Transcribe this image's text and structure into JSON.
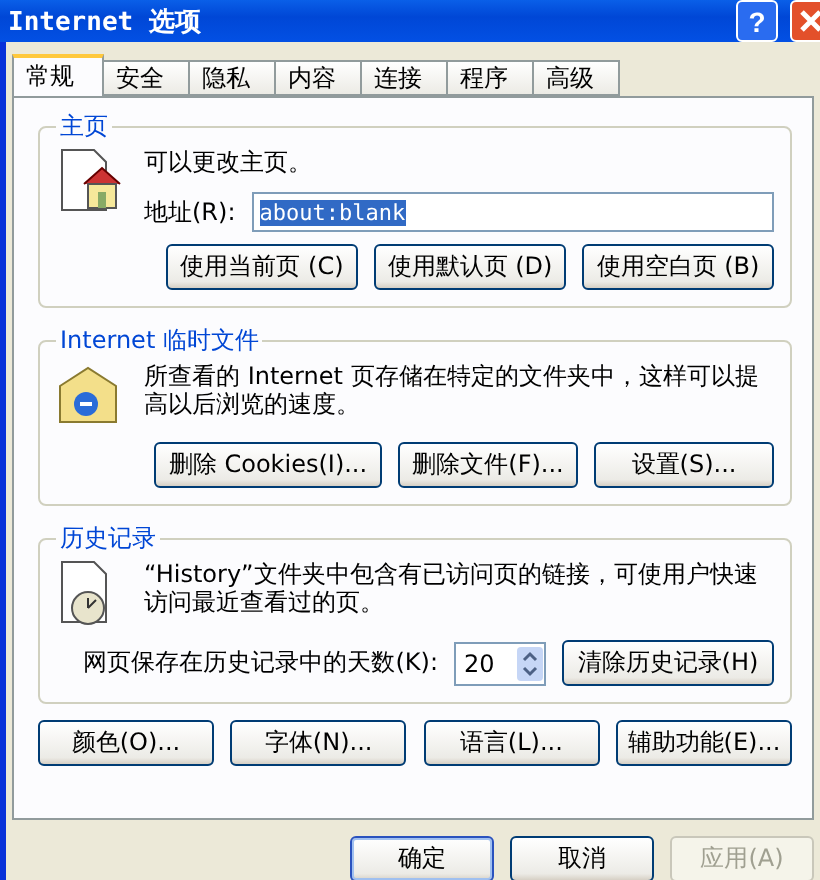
{
  "window": {
    "title": "Internet 选项",
    "help_button": "?"
  },
  "tabs": [
    {
      "label": "常规",
      "selected": true
    },
    {
      "label": "安全",
      "selected": false
    },
    {
      "label": "隐私",
      "selected": false
    },
    {
      "label": "内容",
      "selected": false
    },
    {
      "label": "连接",
      "selected": false
    },
    {
      "label": "程序",
      "selected": false
    },
    {
      "label": "高级",
      "selected": false
    }
  ],
  "home_group": {
    "title": "主页",
    "description": "可以更改主页。",
    "address_label": "地址(R):",
    "address_value": "about:blank",
    "value_selected": true,
    "buttons": [
      "使用当前页 (C)",
      "使用默认页 (D)",
      "使用空白页 (B)"
    ]
  },
  "temp_files_group": {
    "title": "Internet 临时文件",
    "description": "所查看的 Internet 页存储在特定的文件夹中，这样可以提高以后浏览的速度。",
    "buttons": [
      "删除 Cookies(I)...",
      "删除文件(F)...",
      "设置(S)..."
    ]
  },
  "history_group": {
    "title": "历史记录",
    "description": "“History”文件夹中包含有已访问页的链接，可使用户快速访问最近查看过的页。",
    "days_label": "网页保存在历史记录中的天数(K):",
    "days_value": "20",
    "clear_button": "清除历史记录(H)"
  },
  "bottom_buttons": [
    "颜色(O)...",
    "字体(N)...",
    "语言(L)...",
    "辅助功能(E)..."
  ],
  "dialog_buttons": [
    {
      "label": "确定",
      "default": true,
      "disabled": false
    },
    {
      "label": "取消",
      "default": false,
      "disabled": false
    },
    {
      "label": "应用(A)",
      "default": false,
      "disabled": true
    }
  ]
}
